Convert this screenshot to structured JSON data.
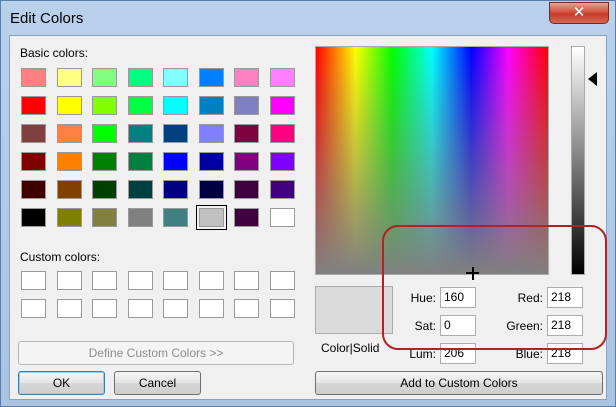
{
  "window": {
    "title": "Edit Colors",
    "close_icon": "close-icon"
  },
  "basic_colors": {
    "label": "Basic colors:",
    "rows": [
      [
        "#ff8080",
        "#ffff80",
        "#80ff80",
        "#00ff80",
        "#80ffff",
        "#0080ff",
        "#ff80c0",
        "#ff80ff"
      ],
      [
        "#ff0000",
        "#ffff00",
        "#80ff00",
        "#00ff40",
        "#00ffff",
        "#0080c0",
        "#8080c0",
        "#ff00ff"
      ],
      [
        "#804040",
        "#ff8040",
        "#00ff00",
        "#008080",
        "#004080",
        "#8080ff",
        "#800040",
        "#ff0080"
      ],
      [
        "#800000",
        "#ff8000",
        "#008000",
        "#008040",
        "#0000ff",
        "#0000a0",
        "#800080",
        "#8000ff"
      ],
      [
        "#400000",
        "#804000",
        "#004000",
        "#004040",
        "#000080",
        "#000040",
        "#400040",
        "#400080"
      ],
      [
        "#000000",
        "#808000",
        "#808040",
        "#808080",
        "#408080",
        "#c0c0c0",
        "#400040",
        "#ffffff"
      ]
    ],
    "selected": "#c0c0c0"
  },
  "custom_colors": {
    "label": "Custom colors:",
    "rows": 2,
    "cols": 8
  },
  "buttons": {
    "define_custom": "Define Custom Colors >>",
    "ok": "OK",
    "cancel": "Cancel",
    "add_to_custom": "Add to Custom Colors"
  },
  "preview": {
    "label": "Color|Solid",
    "color": "#dadada"
  },
  "fields": {
    "hue": {
      "label": "Hue:",
      "value": "160"
    },
    "sat": {
      "label": "Sat:",
      "value": "0"
    },
    "lum": {
      "label": "Lum:",
      "value": "206"
    },
    "red": {
      "label": "Red:",
      "value": "218"
    },
    "green": {
      "label": "Green:",
      "value": "218"
    },
    "blue": {
      "label": "Blue:",
      "value": "218"
    }
  },
  "spectrum": {
    "crosshair_icon": "crosshair-icon"
  },
  "luminance": {
    "arrow_icon": "arrow-left-icon"
  },
  "annotation": {
    "color": "#b22222"
  }
}
